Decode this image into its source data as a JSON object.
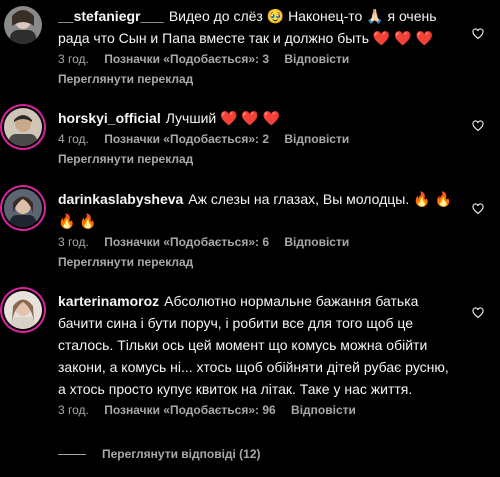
{
  "comments": [
    {
      "username": "__stefaniegr___",
      "text": "Видео до слёз 🥹 Наконец-то 🙏🏻 я очень рада что Сын и Папа вместе так и должно быть ❤️ ❤️ ❤️",
      "age": "3 год.",
      "likes": "Позначки «Подобається»: 3",
      "reply": "Відповісти",
      "translate": "Переглянути переклад"
    },
    {
      "username": "horskyi_official",
      "text": "Лучший ❤️ ❤️ ❤️",
      "age": "4 год.",
      "likes": "Позначки «Подобається»: 2",
      "reply": "Відповісти",
      "translate": "Переглянути переклад"
    },
    {
      "username": "darinkaslabysheva",
      "text": "Аж слезы на глазах, Вы молодцы. 🔥 🔥 🔥 🔥",
      "age": "3 год.",
      "likes": "Позначки «Подобається»: 6",
      "reply": "Відповісти",
      "translate": "Переглянути переклад"
    },
    {
      "username": "karterinamoroz",
      "text": "Абсолютно нормальне бажання батька бачити сина і бути поруч, і робити все для того щоб це сталось. Тільки ось цей момент що комусь можна обійти закони, а комусь ні... хтось щоб обійняти дітей рубає русню, а хтось просто купує квиток на літак. Таке у нас життя.",
      "age": "3 год.",
      "likes": "Позначки «Подобається»: 96",
      "reply": "Відповісти"
    }
  ],
  "view_replies": "Переглянути відповіді (12)",
  "colors": {
    "background": "#000000",
    "text": "#f5f5f5",
    "muted": "#a8a8a8",
    "story_ring": "#d6249f"
  },
  "icons": {
    "like": "heart-outline-icon"
  }
}
